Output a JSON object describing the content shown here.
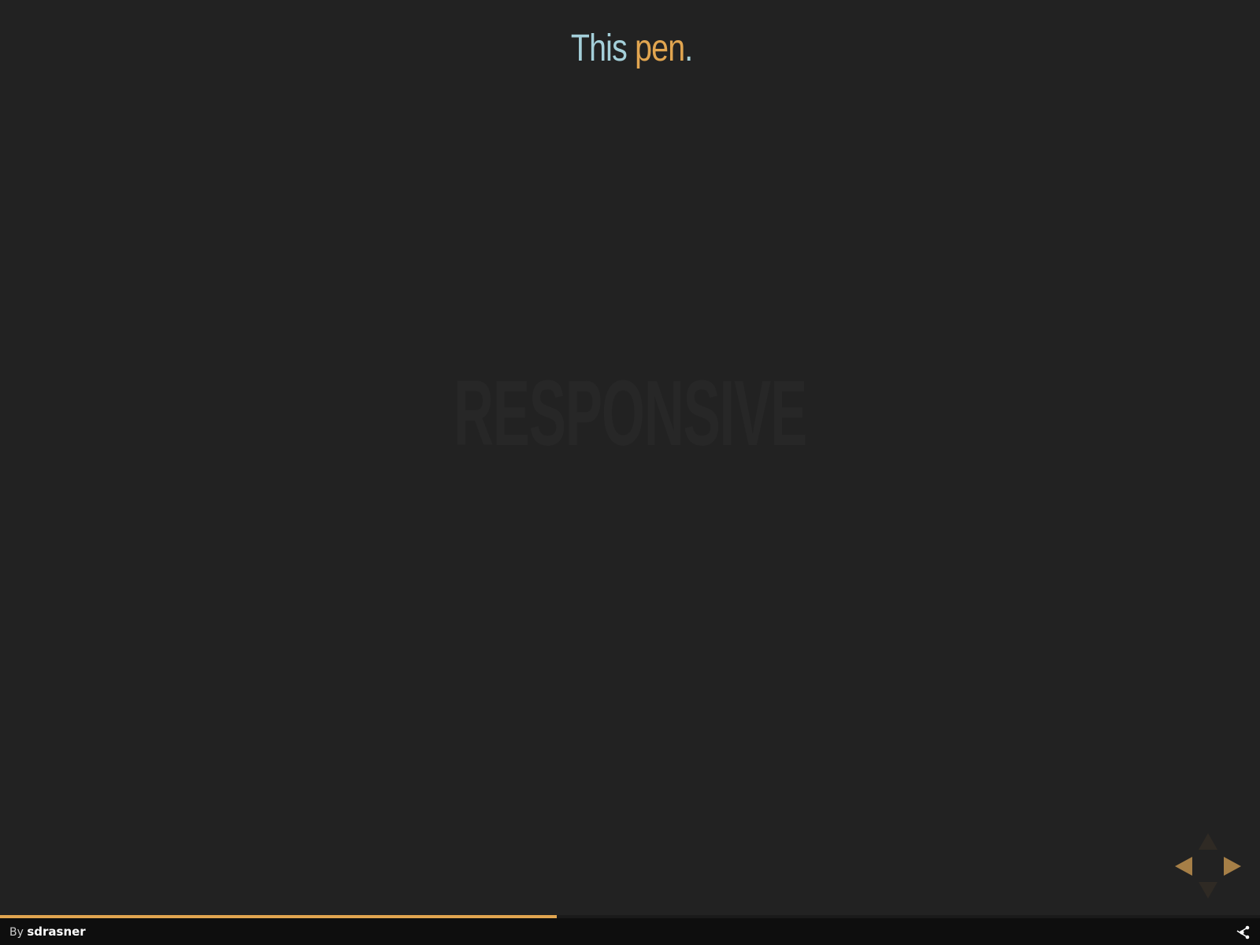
{
  "title": {
    "word1": "This",
    "word2": "pen",
    "punct": "."
  },
  "watermark": "RESPONSIVE",
  "progress": {
    "percent": 44.2
  },
  "footer": {
    "by_label": "By",
    "author": "sdrasner"
  },
  "nav": {
    "icons": [
      "arrow-up-icon",
      "arrow-left-icon",
      "arrow-right-icon",
      "arrow-down-icon"
    ]
  },
  "share_icon": "share-icon",
  "colors": {
    "background": "#222222",
    "title_blue": "#a4cfd9",
    "accent_orange": "#e1a550",
    "footer_bg": "#0e0e0e"
  }
}
